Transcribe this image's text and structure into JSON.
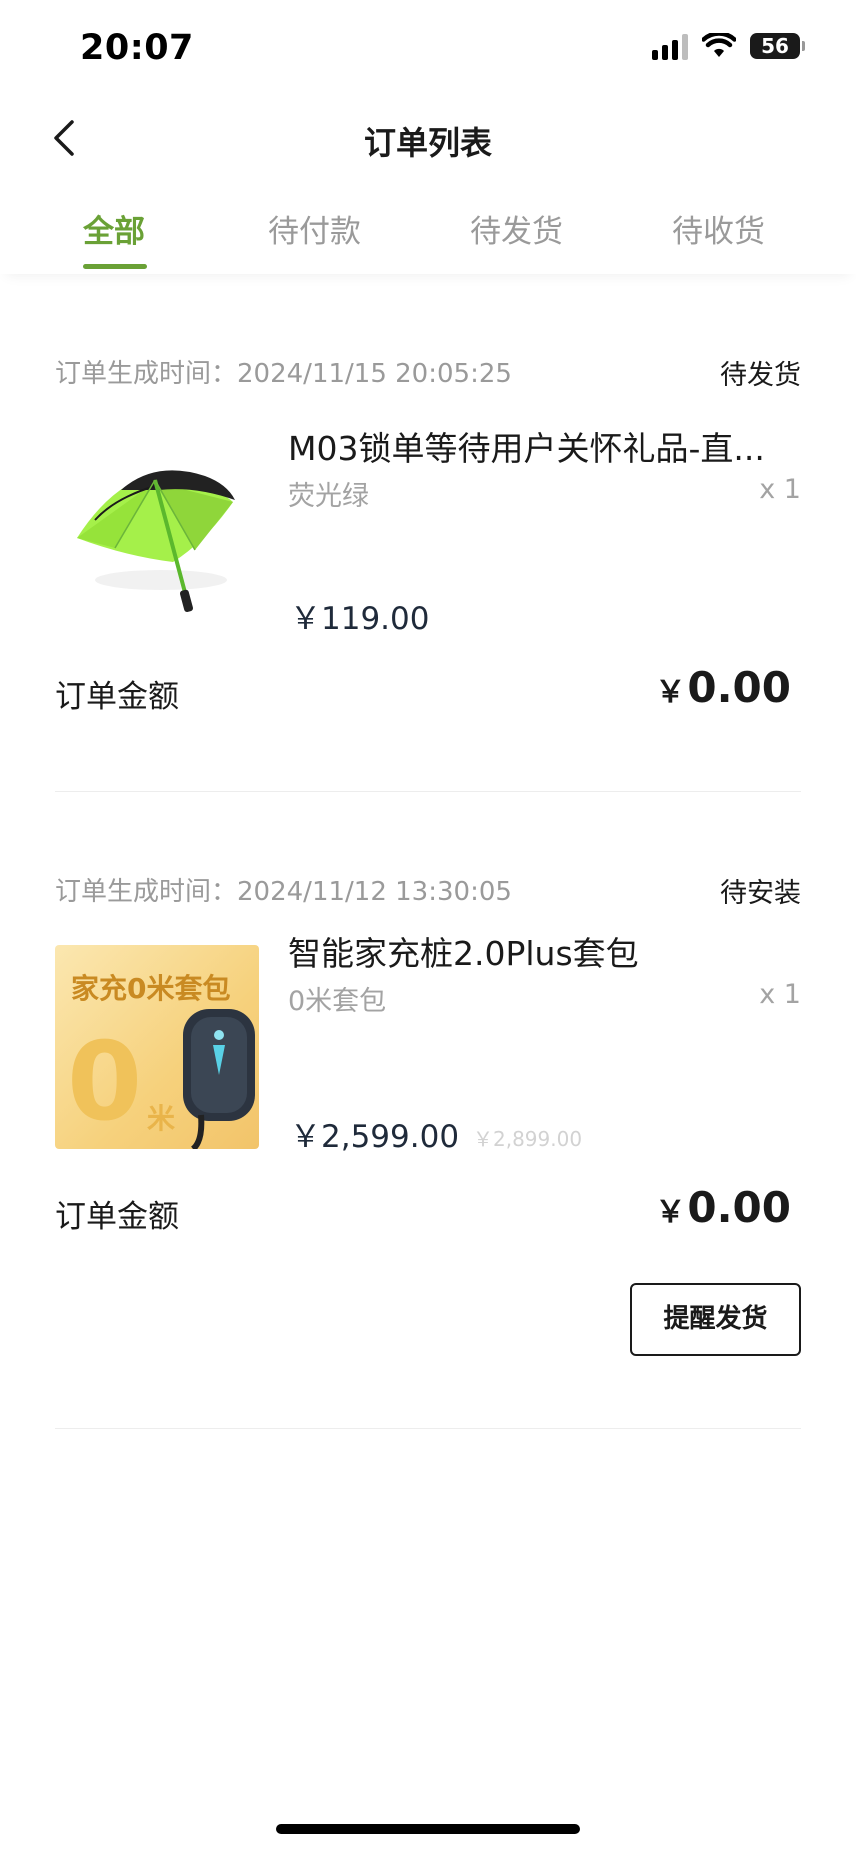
{
  "status_bar": {
    "time": "20:07",
    "battery": "56"
  },
  "header": {
    "title": "订单列表"
  },
  "tabs": [
    {
      "label": "全部",
      "active": true
    },
    {
      "label": "待付款",
      "active": false
    },
    {
      "label": "待发货",
      "active": false
    },
    {
      "label": "待收货",
      "active": false
    }
  ],
  "orders": [
    {
      "time_label": "订单生成时间：",
      "time": "2024/11/15 20:05:25",
      "status": "待发货",
      "product_name": "M03锁单等待用户关怀礼品-直...",
      "product_spec": "荧光绿",
      "quantity": "x 1",
      "price": "￥119.00",
      "amount_label": "订单金额",
      "amount_currency": "￥",
      "amount_value": "0.00",
      "image_icon": "umbrella-image"
    },
    {
      "time_label": "订单生成时间：",
      "time": "2024/11/12 13:30:05",
      "status": "待安装",
      "product_name": "智能家充桩2.0Plus套包",
      "product_spec": "0米套包",
      "quantity": "x 1",
      "price": "￥2,599.00",
      "original_price": "￥2,899.00",
      "amount_label": "订单金额",
      "amount_currency": "￥",
      "amount_value": "0.00",
      "image_text": "家充0米套包",
      "image_big": "0",
      "image_unit": "米",
      "action_button": "提醒发货"
    }
  ],
  "colors": {
    "accent": "#6aa136",
    "text_primary": "#1a1a1a",
    "text_secondary": "#9a9a9a"
  }
}
